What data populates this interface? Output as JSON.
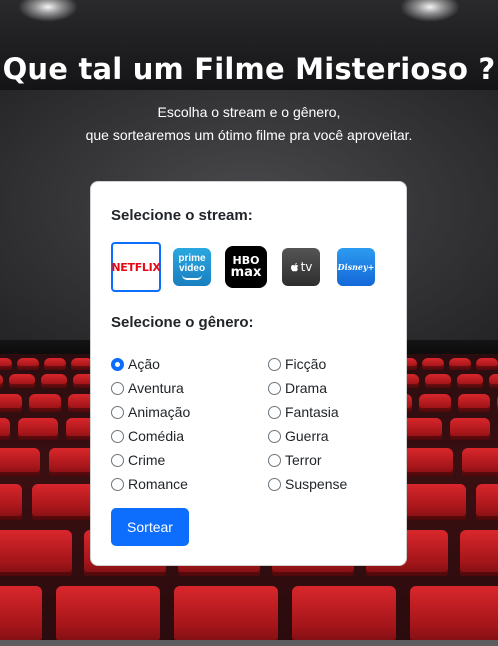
{
  "header": {
    "title": "Que tal um Filme Misterioso ?",
    "subtitle_line1": "Escolha o stream e o gênero,",
    "subtitle_line2": "que sortearemos um ótimo filme pra você aproveitar."
  },
  "card": {
    "stream_label": "Selecione o stream:",
    "genre_label": "Selecione o gênero:",
    "streams": [
      {
        "name": "netflix",
        "text": "NETFLIX",
        "selected": true
      },
      {
        "name": "prime-video",
        "text_line1": "prime",
        "text_line2": "video"
      },
      {
        "name": "hbo-max",
        "text_line1": "HBO",
        "text_line2": "max"
      },
      {
        "name": "apple-tv",
        "text": "tv"
      },
      {
        "name": "disney-plus",
        "text": "Disney+"
      }
    ],
    "genres_left": [
      "Ação",
      "Aventura",
      "Animação",
      "Comédia",
      "Crime",
      "Romance"
    ],
    "genres_right": [
      "Ficção",
      "Drama",
      "Fantasia",
      "Guerra",
      "Terror",
      "Suspense"
    ],
    "selected_genre": "Ação",
    "button_label": "Sortear"
  },
  "colors": {
    "accent": "#0d6efd",
    "netflix": "#e50914",
    "seat": "#c81e23"
  }
}
